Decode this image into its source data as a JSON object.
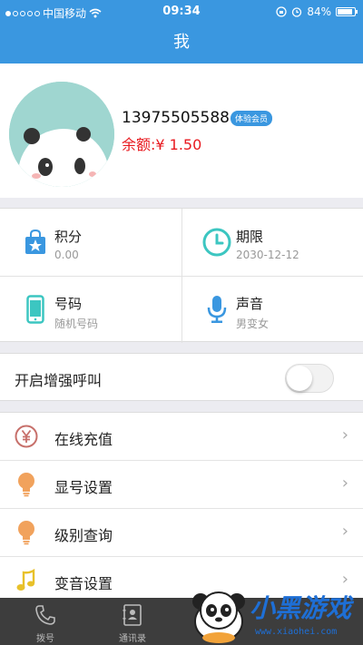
{
  "status_bar": {
    "carrier": "中国移动",
    "time": "09:34",
    "battery": "84%"
  },
  "header": {
    "title": "我"
  },
  "profile": {
    "phone": "13975505588",
    "badge": "体验会员",
    "balance": "余额:¥ 1.50"
  },
  "info_grid": [
    {
      "title": "积分",
      "value": "0.00",
      "icon": "shopping-bag-star-icon",
      "color": "#3a97e0"
    },
    {
      "title": "期限",
      "value": "2030-12-12",
      "icon": "clock-icon",
      "color": "#3cc6c1"
    },
    {
      "title": "号码",
      "value": "随机号码",
      "icon": "phone-device-icon",
      "color": "#3cc6c1"
    },
    {
      "title": "声音",
      "value": "男变女",
      "icon": "microphone-icon",
      "color": "#3a97e0"
    }
  ],
  "enhanced_call": {
    "label": "开启增强呼叫",
    "enabled": false
  },
  "menu": [
    {
      "label": "在线充值",
      "icon": "yuan-circle-icon"
    },
    {
      "label": "显号设置",
      "icon": "lightbulb-icon"
    },
    {
      "label": "级别查询",
      "icon": "lightbulb-icon"
    },
    {
      "label": "变音设置",
      "icon": "music-note-icon"
    }
  ],
  "tabs": [
    {
      "label": "拨号",
      "icon": "phone-handset-icon"
    },
    {
      "label": "通讯录",
      "icon": "contacts-book-icon"
    }
  ],
  "watermark": {
    "text": "小黑游戏",
    "url": "www.xiaohei.com"
  },
  "colors": {
    "accent": "#3a97e0",
    "balance": "#e8191f",
    "tabbar": "#3d3d3d"
  }
}
